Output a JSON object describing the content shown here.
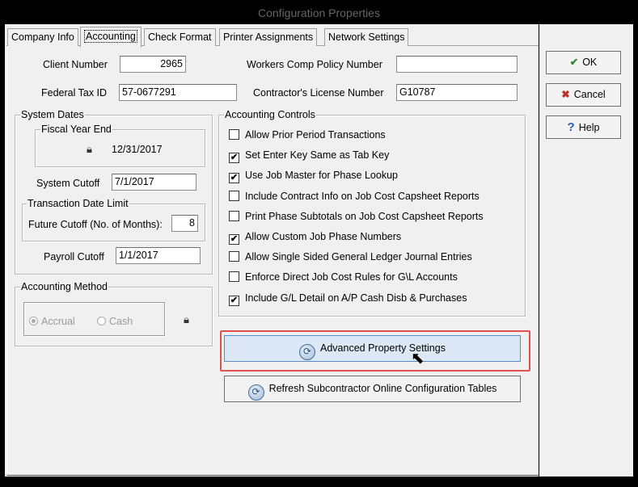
{
  "window": {
    "title": "Configuration Properties",
    "title_partial_above": "· · · · · · · ·"
  },
  "tabs": [
    {
      "label": "Company Info",
      "active": false
    },
    {
      "label": "Accounting",
      "active": true
    },
    {
      "label": "Check Format",
      "active": false
    },
    {
      "label": "Printer Assignments",
      "active": false
    },
    {
      "label": "Network Settings",
      "active": false
    }
  ],
  "fields": {
    "client_number": {
      "label": "Client Number",
      "value": "2965"
    },
    "workers_comp": {
      "label": "Workers Comp Policy Number",
      "value": ""
    },
    "federal_tax": {
      "label": "Federal Tax ID",
      "value": "57-0677291"
    },
    "contractor_license": {
      "label": "Contractor's License Number",
      "value": "G10787"
    }
  },
  "system_dates": {
    "legend": "System Dates",
    "fiscal_legend": "Fiscal Year End",
    "fiscal_value": "12/31/2017",
    "cutoff_label": "System Cutoff",
    "cutoff_value": "7/1/2017",
    "txn_legend": "Transaction Date Limit",
    "future_label": "Future Cutoff (No. of Months):",
    "future_value": "8",
    "payroll_label": "Payroll Cutoff",
    "payroll_value": "1/1/2017"
  },
  "accounting_method": {
    "legend": "Accounting Method",
    "accrual": "Accrual",
    "cash": "Cash",
    "selected": "Accrual"
  },
  "accounting_controls": {
    "legend": "Accounting Controls",
    "items": [
      {
        "label": "Allow Prior Period Transactions",
        "checked": false
      },
      {
        "label": "Set Enter Key Same as Tab Key",
        "checked": true
      },
      {
        "label": "Use Job Master for Phase Lookup",
        "checked": true
      },
      {
        "label": "Include Contract Info on Job Cost Capsheet Reports",
        "checked": false
      },
      {
        "label": "Print Phase Subtotals on Job Cost Capsheet Reports",
        "checked": false
      },
      {
        "label": "Allow Custom Job Phase Numbers",
        "checked": true
      },
      {
        "label": "Allow Single Sided General Ledger Journal Entries",
        "checked": false
      },
      {
        "label": "Enforce Direct Job Cost Rules for G\\L Accounts",
        "checked": false
      },
      {
        "label": "Include G/L Detail on A/P Cash Disb & Purchases",
        "checked": true
      }
    ]
  },
  "buttons": {
    "advanced": "Advanced Property Settings",
    "refresh": "Refresh Subcontractor Online Configuration Tables",
    "ok": "OK",
    "cancel": "Cancel",
    "help": "Help"
  },
  "check_mark": "✔",
  "colors": {
    "highlight": "#e0504c",
    "advanced_button_bg": "#dce8f5",
    "ok_check": "#2e8b2e",
    "cancel_x": "#c0302a",
    "help_q": "#2a5db0"
  }
}
